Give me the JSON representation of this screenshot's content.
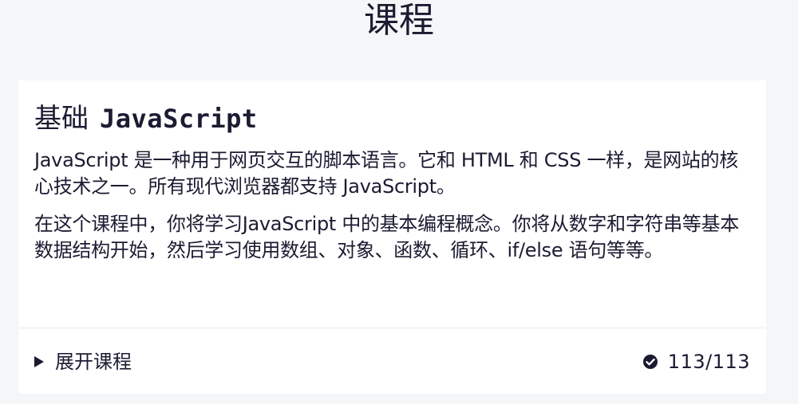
{
  "page": {
    "title": "课程"
  },
  "course": {
    "title_cn": "基础",
    "title_code": "JavaScript",
    "paragraphs": [
      "JavaScript 是一种用于网页交互的脚本语言。它和 HTML 和 CSS 一样，是网站的核心技术之一。所有现代浏览器都支持 JavaScript。",
      "在这个课程中，你将学习JavaScript 中的基本编程概念。你将从数字和字符串等基本数据结构开始，然后学习使用数组、对象、函数、循环、if/else 语句等等。"
    ],
    "expand_label": "展开课程",
    "progress": {
      "completed": 113,
      "total": 113,
      "label": "113/113"
    }
  },
  "icons": {
    "expand": "triangle-right-icon",
    "progress": "check-circle-icon"
  },
  "colors": {
    "background": "#f5f6f7",
    "card": "#ffffff",
    "text": "#1b1b32"
  }
}
